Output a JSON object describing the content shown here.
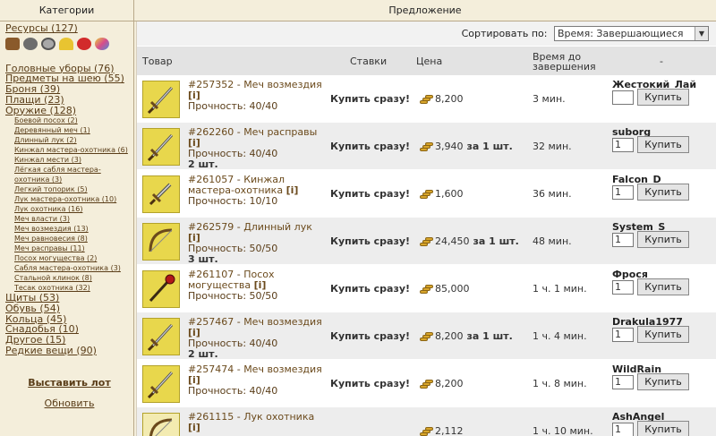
{
  "header": {
    "left_title": "Категории",
    "right_title": "Предложение"
  },
  "sidebar": {
    "resources": "Ресурсы (127)",
    "resource_icons": [
      "wood-icon",
      "ore-icon",
      "mercury-icon",
      "sulfur-icon",
      "crystal-icon",
      "gem-icon"
    ],
    "categories": [
      "Головные уборы (76)",
      "Предметы на шею (55)",
      "Броня (39)",
      "Плащи (23)",
      "Оружие (128)"
    ],
    "weapon_subcategories": [
      "Боевой посох (2)",
      "Деревянный меч (1)",
      "Длинный лук (2)",
      "Кинжал мастера-охотника (6)",
      "Кинжал мести (3)",
      "Лёгкая сабля мастера-охотника (3)",
      "Легкий топорик (5)",
      "Лук мастера-охотника (10)",
      "Лук охотника (16)",
      "Меч власти (3)",
      "Меч возмездия (13)",
      "Меч равновесия (8)",
      "Меч расправы (11)",
      "Посох могущества (2)",
      "Сабля мастера-охотника (3)",
      "Стальной клинок (8)",
      "Тесак охотника (32)"
    ],
    "categories_after": [
      "Щиты (53)",
      "Обувь (54)",
      "Кольца (45)",
      "Снадобья (10)",
      "Другое (15)",
      "Редкие вещи (90)"
    ],
    "place_lot": "Выставить лот",
    "refresh": "Обновить"
  },
  "sort": {
    "label": "Сортировать по:",
    "selected": "Время: Завершающиеся"
  },
  "table": {
    "headers": {
      "item": "Товар",
      "bids": "Ставки",
      "price": "Цена",
      "time_line1": "Время до",
      "time_line2": "завершения",
      "actions": "-"
    },
    "rows": [
      {
        "id": "#257352",
        "name": "Меч возмездия",
        "info": "[i]",
        "durability": "Прочность: 40/40",
        "qty": "",
        "buy_now": "Купить сразу!",
        "price": "8,200",
        "per_unit": "",
        "time": "3 мин.",
        "seller": "Жестокий_Лай",
        "qty_input": "",
        "buy": "Купить",
        "icon": "sword-icon"
      },
      {
        "id": "#262260",
        "name": "Меч расправы",
        "info": "[i]",
        "durability": "Прочность: 40/40",
        "qty": "2 шт.",
        "buy_now": "Купить сразу!",
        "price": "3,940",
        "per_unit": "за 1 шт.",
        "time": "32 мин.",
        "seller": "suborg",
        "qty_input": "1",
        "buy": "Купить",
        "icon": "sword-icon"
      },
      {
        "id": "#261057",
        "name": "Кинжал мастера-охотника",
        "info": "[i]",
        "durability": "Прочность: 10/10",
        "qty": "",
        "buy_now": "Купить сразу!",
        "price": "1,600",
        "per_unit": "",
        "time": "36 мин.",
        "seller": "Falcon_D",
        "qty_input": "1",
        "buy": "Купить",
        "icon": "dagger-icon"
      },
      {
        "id": "#262579",
        "name": "Длинный лук",
        "info": "[i]",
        "durability": "Прочность: 50/50",
        "qty": "3 шт.",
        "buy_now": "Купить сразу!",
        "price": "24,450",
        "per_unit": "за 1 шт.",
        "time": "48 мин.",
        "seller": "System_S",
        "qty_input": "1",
        "buy": "Купить",
        "icon": "bow-icon"
      },
      {
        "id": "#261107",
        "name": "Посох могущества",
        "info": "[i]",
        "durability": "Прочность: 50/50",
        "qty": "",
        "buy_now": "Купить сразу!",
        "price": "85,000",
        "per_unit": "",
        "time": "1 ч. 1 мин.",
        "seller": "Фрося",
        "qty_input": "1",
        "buy": "Купить",
        "icon": "staff-icon"
      },
      {
        "id": "#257467",
        "name": "Меч возмездия",
        "info": "[i]",
        "durability": "Прочность: 40/40",
        "qty": "2 шт.",
        "buy_now": "Купить сразу!",
        "price": "8,200",
        "per_unit": "за 1 шт.",
        "time": "1 ч. 4 мин.",
        "seller": "Drakula1977",
        "qty_input": "1",
        "buy": "Купить",
        "icon": "sword-icon"
      },
      {
        "id": "#257474",
        "name": "Меч возмездия",
        "info": "[i]",
        "durability": "Прочность: 40/40",
        "qty": "",
        "buy_now": "Купить сразу!",
        "price": "8,200",
        "per_unit": "",
        "time": "1 ч. 8 мин.",
        "seller": "WildRain",
        "qty_input": "1",
        "buy": "Купить",
        "icon": "sword-icon"
      },
      {
        "id": "#261115",
        "name": "Лук охотника",
        "info": "[i]",
        "durability": "",
        "qty": "",
        "buy_now": "",
        "price": "2,112",
        "per_unit": "",
        "time": "1 ч. 10 мин.",
        "seller": "AshAngel",
        "qty_input": "1",
        "buy": "Купить",
        "icon": "bow-icon"
      }
    ]
  }
}
